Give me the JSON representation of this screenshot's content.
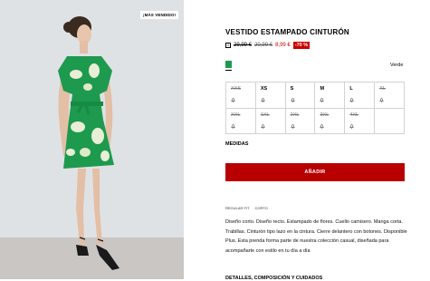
{
  "image": {
    "badge": "¡MÁS VENDIDO!",
    "colors": {
      "background": "#dde0e3",
      "dress": "#1d9a4e",
      "floor": "#c9c6c3"
    }
  },
  "product": {
    "title": "VESTIDO ESTAMPADO CINTURÓN",
    "price_original_1": "29,99 €",
    "price_original_2": "20,99 €",
    "price_sale": "8,99 €",
    "discount": "-70 %",
    "color_name": "Verde",
    "swatch_color": "#1d9a4e"
  },
  "sizes": [
    {
      "label": "XXS",
      "available": false
    },
    {
      "label": "XS",
      "available": true
    },
    {
      "label": "S",
      "available": true
    },
    {
      "label": "M",
      "available": true
    },
    {
      "label": "L",
      "available": true
    },
    {
      "label": "XL",
      "available": false
    },
    {
      "label": "XXL",
      "available": false
    },
    {
      "label": "1XL",
      "available": false
    },
    {
      "label": "2XL",
      "available": false
    },
    {
      "label": "3XL",
      "available": false
    },
    {
      "label": "4XL",
      "available": false
    }
  ],
  "medidas_label": "MEDIDAS",
  "add_button": "AÑADIR",
  "tags": [
    "REGULAR FIT",
    "CORTO"
  ],
  "description": "Diseño corto. Diseño recto. Estampado de flores. Cuello camisero. Manga corta. Trabillas. Cinturón tipo lazo en la cintura. Cierre delantero con botones. Disponible Plus. Esta prenda forma parte de nuestra colección casual, diseñada para acompañarte con estilo en tu día a día",
  "details_label": "DETALLES, COMPOSICIÓN Y CUIDADOS",
  "accent_color": "#b80000"
}
